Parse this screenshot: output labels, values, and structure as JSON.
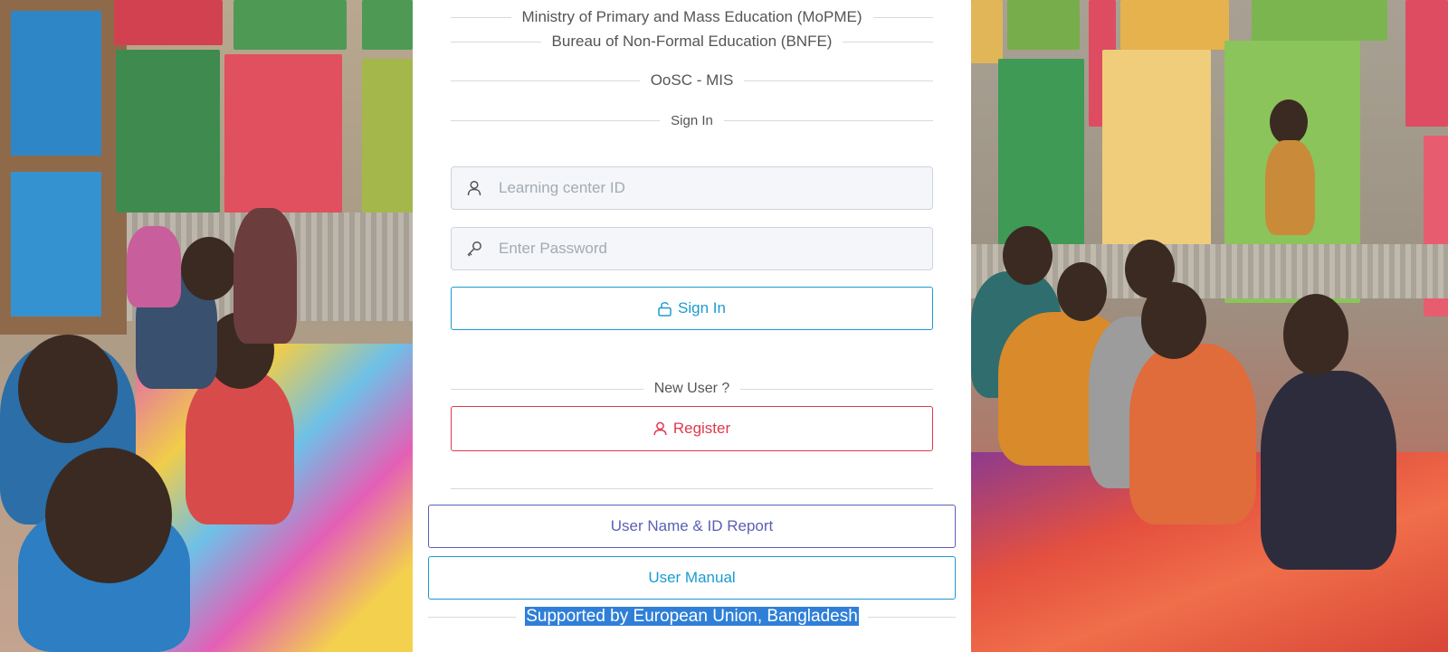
{
  "header": {
    "ministry": "Ministry of Primary and Mass Education (MoPME)",
    "bureau": "Bureau of Non-Formal Education (BNFE)",
    "system": "OoSC - MIS",
    "sign_in_heading": "Sign In"
  },
  "login_form": {
    "learning_center_placeholder": "Learning center ID",
    "learning_center_value": "",
    "password_placeholder": "Enter Password",
    "password_value": "",
    "user_icon": "user-icon",
    "key_icon": "key-icon",
    "sign_in_label": "Sign In",
    "sign_in_icon": "unlock-icon"
  },
  "registration": {
    "new_user_heading": "New User ?",
    "register_label": "Register",
    "register_icon": "user-icon"
  },
  "links": {
    "report_label": "User Name & ID Report",
    "manual_label": "User Manual"
  },
  "footer": {
    "support_text": "Supported by European Union, Bangladesh"
  },
  "colors": {
    "primary": "#1a9bd0",
    "danger": "#e0394c",
    "report": "#5a5fb5",
    "selection": "#2f7fd8"
  }
}
